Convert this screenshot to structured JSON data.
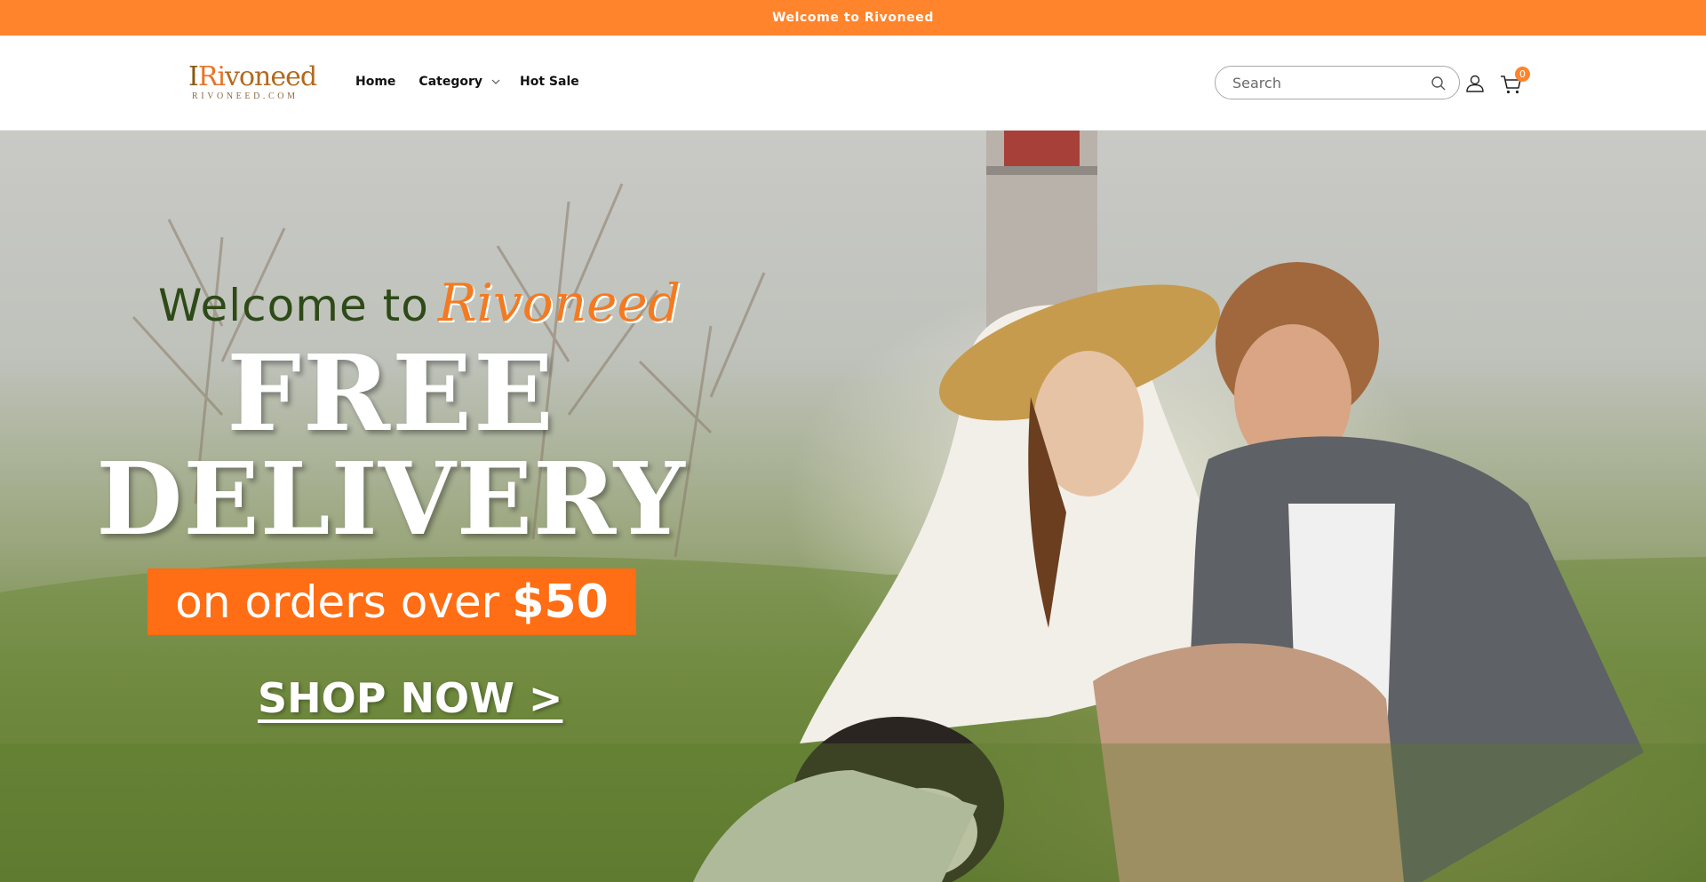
{
  "announcement": {
    "text": "Welcome to Rivoneed"
  },
  "header": {
    "logo": {
      "main_prefix": "I",
      "main_mid": "Ri",
      "main_rest": "voneed",
      "sub": "RIVONEED.COM"
    },
    "nav": [
      {
        "label": "Home",
        "tail": ""
      },
      {
        "label": "Category",
        "has_dropdown": true
      },
      {
        "label": "Hot Sale"
      }
    ],
    "search": {
      "placeholder": "Search"
    },
    "cart": {
      "count": "0"
    }
  },
  "hero": {
    "welcome_prefix": "Welcome to",
    "welcome_brand": "Rivoneed",
    "line1": "FREE",
    "line2": "DELIVERY",
    "orders_prefix": "on orders over",
    "orders_amount": "$50",
    "cta": "SHOP NOW >"
  },
  "colors": {
    "accent": "#ff842c",
    "hero_badge": "#ff6d14",
    "welcome_green": "#2d4a17"
  }
}
